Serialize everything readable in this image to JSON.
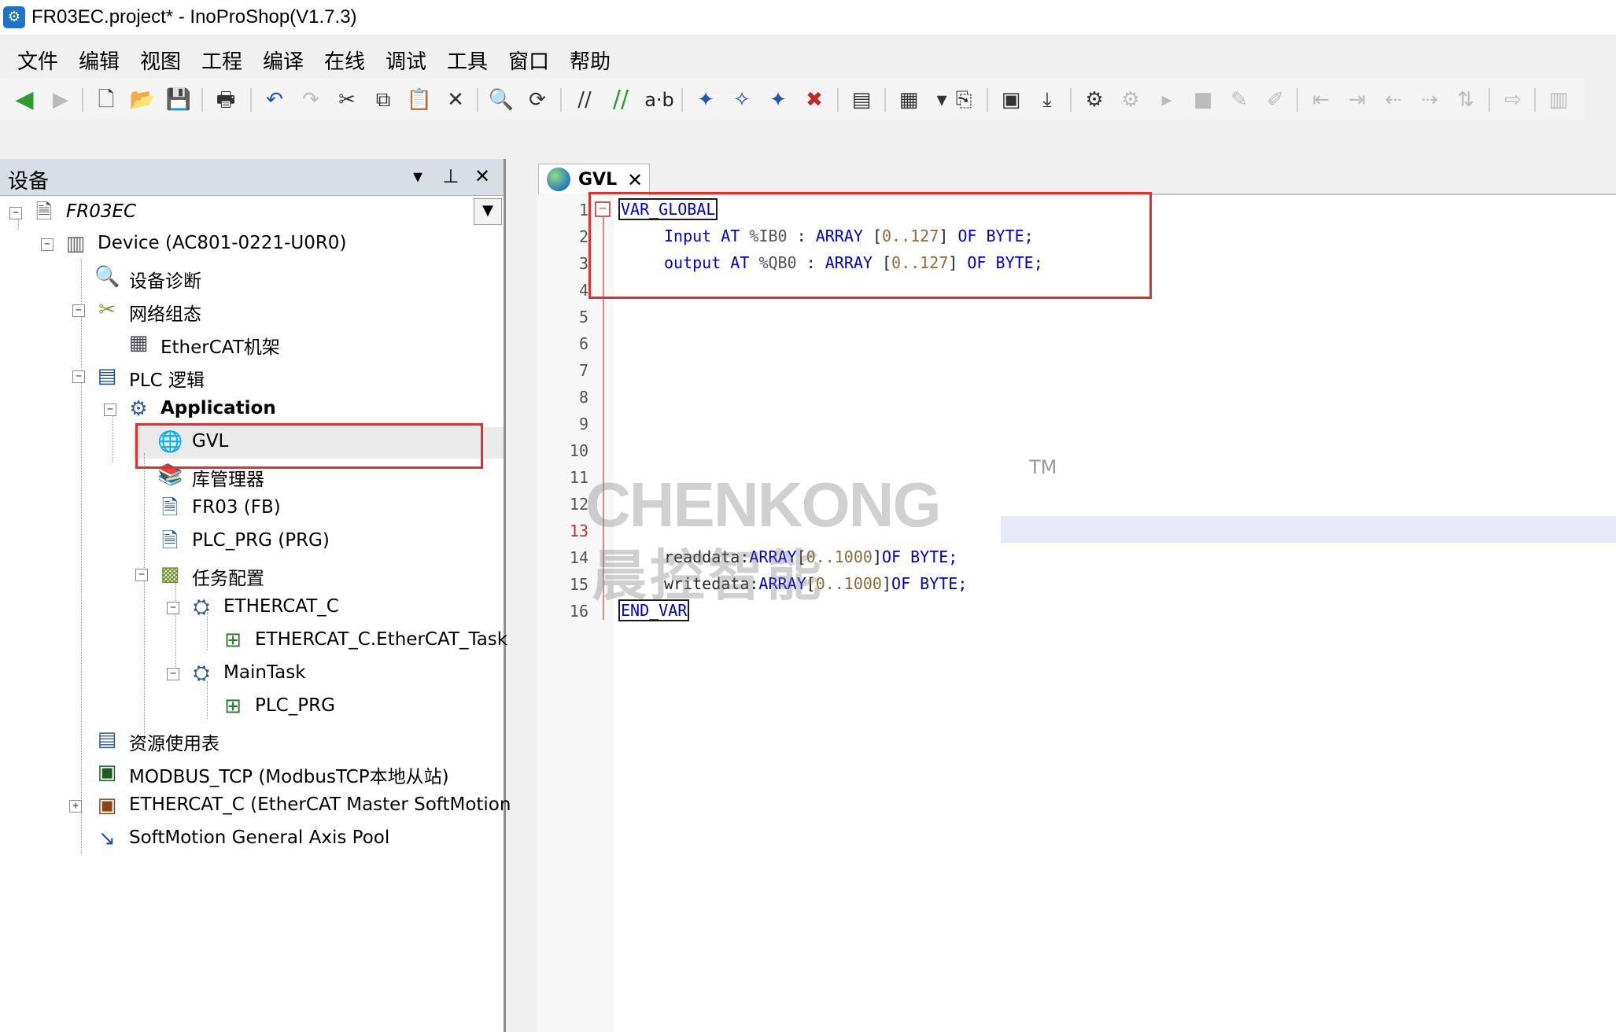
{
  "window": {
    "title": "FR03EC.project* - InoProShop(V1.7.3)"
  },
  "menu": [
    "文件",
    "编辑",
    "视图",
    "工程",
    "编译",
    "在线",
    "调试",
    "工具",
    "窗口",
    "帮助"
  ],
  "toolbar": {
    "find_replace_label": "a·b"
  },
  "device_panel": {
    "title": "设备",
    "tree": [
      {
        "label": "FR03EC"
      },
      {
        "label": "Device (AC801-0221-U0R0)"
      },
      {
        "label": "设备诊断"
      },
      {
        "label": "网络组态"
      },
      {
        "label": "EtherCAT机架"
      },
      {
        "label": "PLC 逻辑"
      },
      {
        "label": "Application"
      },
      {
        "label": "GVL"
      },
      {
        "label": "库管理器"
      },
      {
        "label": "FR03 (FB)"
      },
      {
        "label": "PLC_PRG (PRG)"
      },
      {
        "label": "任务配置"
      },
      {
        "label": "ETHERCAT_C"
      },
      {
        "label": "ETHERCAT_C.EtherCAT_Task"
      },
      {
        "label": "MainTask"
      },
      {
        "label": "PLC_PRG"
      },
      {
        "label": "资源使用表"
      },
      {
        "label": "MODBUS_TCP (ModbusTCP本地从站)"
      },
      {
        "label": "ETHERCAT_C (EtherCAT Master SoftMotion)"
      },
      {
        "label": "SoftMotion General Axis Pool"
      }
    ]
  },
  "editor": {
    "tab_label": "GVL",
    "current_line": 13,
    "line_numbers": [
      "1",
      "2",
      "3",
      "4",
      "5",
      "6",
      "7",
      "8",
      "9",
      "10",
      "11",
      "12",
      "13",
      "14",
      "15",
      "16"
    ],
    "code": {
      "l1_kw": "VAR_GLOBAL",
      "l2": {
        "name": "Input",
        "at": "AT",
        "addr": "%IB0",
        "colon": " : ",
        "array": "ARRAY",
        "range_open": " [",
        "range": "0..127",
        "range_close": "] ",
        "of": "OF",
        "type": "BYTE;"
      },
      "l3": {
        "name": "output",
        "at": "AT",
        "addr": "%QB0",
        "colon": " : ",
        "array": "ARRAY",
        "range_open": " [",
        "range": "0..127",
        "range_close": "] ",
        "of": "OF",
        "type": "BYTE;"
      },
      "l14": {
        "name": "readdata",
        "colon": ":",
        "array": "ARRAY",
        "range_open": "[",
        "range": "0..1000",
        "range_close": "]",
        "of": "OF",
        "type": " BYTE;"
      },
      "l15": {
        "name": "writedata",
        "colon": ":",
        "array": "ARRAY",
        "range_open": "[",
        "range": "0..1000",
        "range_close": "]",
        "of": "OF",
        "type": " BYTE;"
      },
      "l16_kw": "END_VAR"
    }
  },
  "watermark": {
    "brand": "CHENKONG",
    "tm": "TM",
    "cn": "晨控智能"
  }
}
